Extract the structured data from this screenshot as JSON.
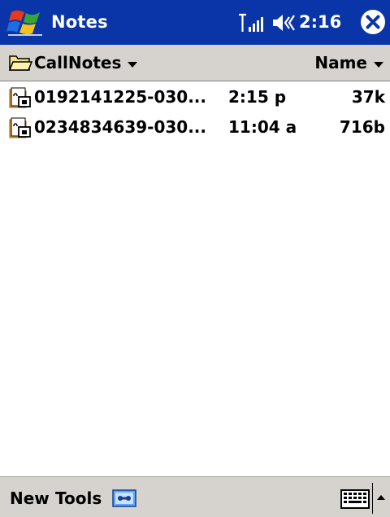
{
  "titlebar": {
    "app_title": "Notes",
    "clock": "2:16",
    "start_icon": "windows-flag-icon",
    "signal_icon": "signal-strength-icon",
    "volume_icon": "speaker-volume-icon",
    "close_icon": "close-icon"
  },
  "folderbar": {
    "folder_label": "CallNotes",
    "sort_label": "Name"
  },
  "files": [
    {
      "name": "0192141225-030...",
      "time": "2:15 p",
      "size": "37k",
      "icon": "voice-note-icon"
    },
    {
      "name": "0234834639-030...",
      "time": "11:04 a",
      "size": "716b",
      "icon": "voice-note-icon"
    }
  ],
  "menubar": {
    "new_label": "New",
    "tools_label": "Tools",
    "record_icon": "recording-toolbar-icon",
    "keyboard_icon": "keyboard-icon",
    "sip_arrow_icon": "up-arrow-icon"
  },
  "colors": {
    "titlebar_bg": "#0a35a8",
    "bar_bg": "#d6d3ce",
    "background": "#ffffff"
  }
}
